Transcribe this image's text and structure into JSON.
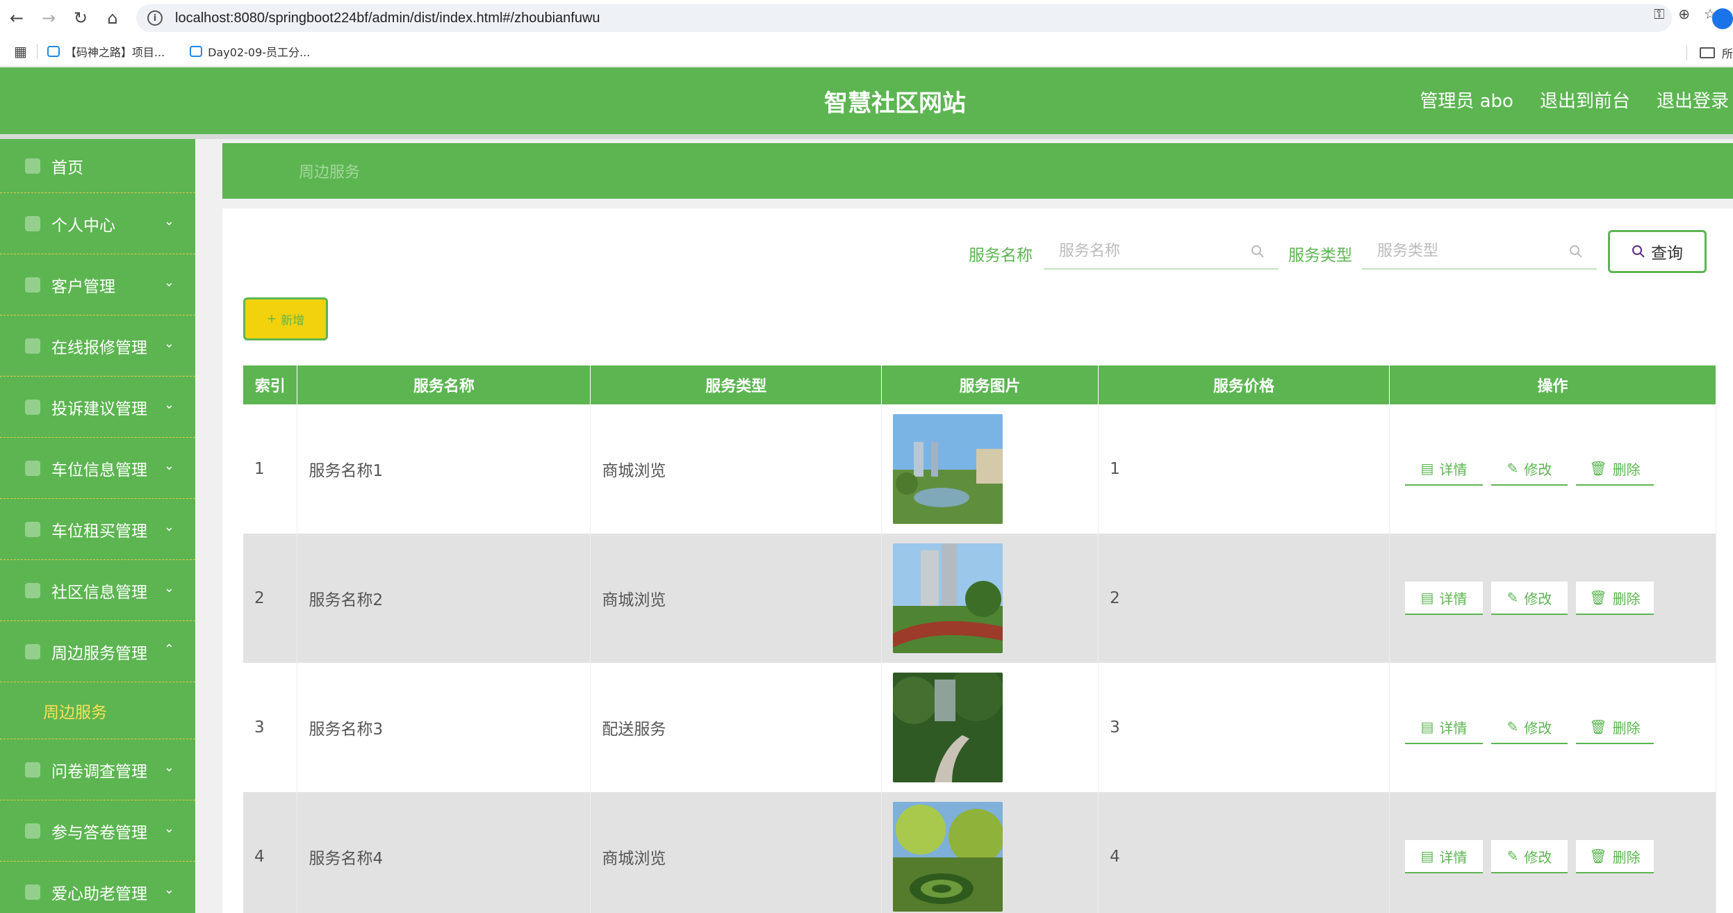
{
  "browser": {
    "url": "localhost:8080/springboot224bf/admin/dist/index.html#/zhoubianfuwu",
    "bookmarks": [
      "【码神之路】项目...",
      "Day02-09-员工分..."
    ],
    "bookmark_folder": "所"
  },
  "header": {
    "title": "智慧社区网站",
    "user": "管理员 abo",
    "to_front": "退出到前台",
    "logout": "退出登录"
  },
  "sidebar": {
    "items": [
      {
        "label": "首页"
      },
      {
        "label": "个人中心"
      },
      {
        "label": "客户管理"
      },
      {
        "label": "在线报修管理"
      },
      {
        "label": "投诉建议管理"
      },
      {
        "label": "车位信息管理"
      },
      {
        "label": "车位租买管理"
      },
      {
        "label": "社区信息管理"
      },
      {
        "label": "周边服务管理"
      },
      {
        "label": "问卷调查管理"
      },
      {
        "label": "参与答卷管理"
      },
      {
        "label": "爱心助老管理"
      }
    ],
    "active_sub": "周边服务"
  },
  "breadcrumb": "周边服务",
  "search": {
    "name_label": "服务名称",
    "name_placeholder": "服务名称",
    "type_label": "服务类型",
    "type_placeholder": "服务类型",
    "query": "查询"
  },
  "add_label": "新增",
  "table": {
    "headers": [
      "索引",
      "服务名称",
      "服务类型",
      "服务图片",
      "服务价格",
      "操作"
    ],
    "rows": [
      {
        "index": "1",
        "name": "服务名称1",
        "type": "商城浏览",
        "price": "1"
      },
      {
        "index": "2",
        "name": "服务名称2",
        "type": "商城浏览",
        "price": "2"
      },
      {
        "index": "3",
        "name": "服务名称3",
        "type": "配送服务",
        "price": "3"
      },
      {
        "index": "4",
        "name": "服务名称4",
        "type": "商城浏览",
        "price": "4"
      }
    ],
    "actions": {
      "detail": "详情",
      "edit": "修改",
      "delete": "删除"
    }
  },
  "colors": {
    "primary": "#5cb551",
    "accent": "#f2d10d",
    "active_sub": "#f7e25a"
  }
}
